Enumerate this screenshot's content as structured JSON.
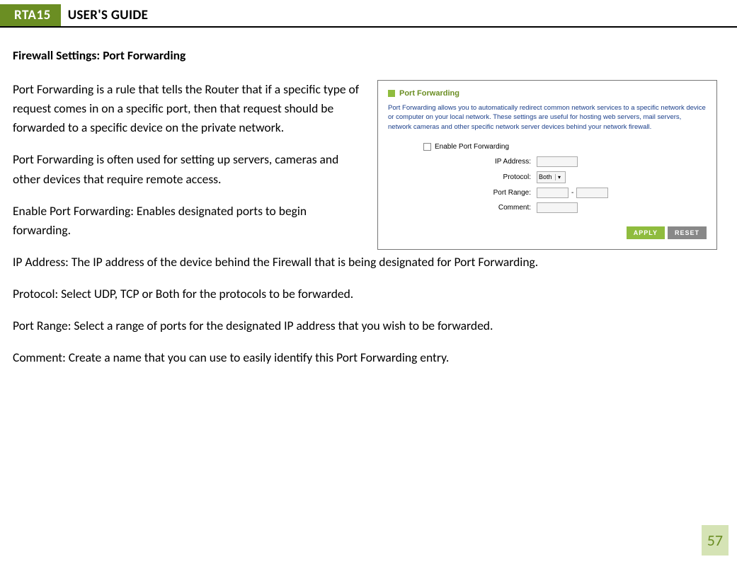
{
  "header": {
    "product": "RTA15",
    "title": "USER'S GUIDE"
  },
  "section_title": "Firewall Settings: Port Forwarding",
  "paragraphs": {
    "p1": "Port Forwarding is a rule that tells the Router that if a specific type of request comes in on a specific port, then that request should be forwarded to a specific device on the private network.",
    "p2": "Port Forwarding is often used for setting up servers, cameras and other devices that require remote access.",
    "p3": "Enable Port Forwarding: Enables designated ports to begin forwarding.",
    "p4": "IP Address:  The IP address of the device behind the Firewall that is being designated for Port Forwarding.",
    "p5": "Protocol: Select UDP, TCP or Both for the protocols to be forwarded.",
    "p6": "Port Range: Select a range of ports for the designated IP address that you wish to be forwarded.",
    "p7": "Comment: Create a name that you can use to easily identify this Port Forwarding entry."
  },
  "screenshot": {
    "heading": "Port Forwarding",
    "description": "Port Forwarding allows you to automatically redirect common network services to a specific network device or computer on your local network. These settings are useful for hosting web servers, mail servers, network cameras and other specific network server devices behind your network firewall.",
    "enable_label": "Enable Port Forwarding",
    "labels": {
      "ip": "IP Address:",
      "protocol": "Protocol:",
      "port_range": "Port Range:",
      "comment": "Comment:"
    },
    "protocol_value": "Both",
    "range_dash": "-",
    "buttons": {
      "apply": "APPLY",
      "reset": "RESET"
    }
  },
  "page_number": "57"
}
